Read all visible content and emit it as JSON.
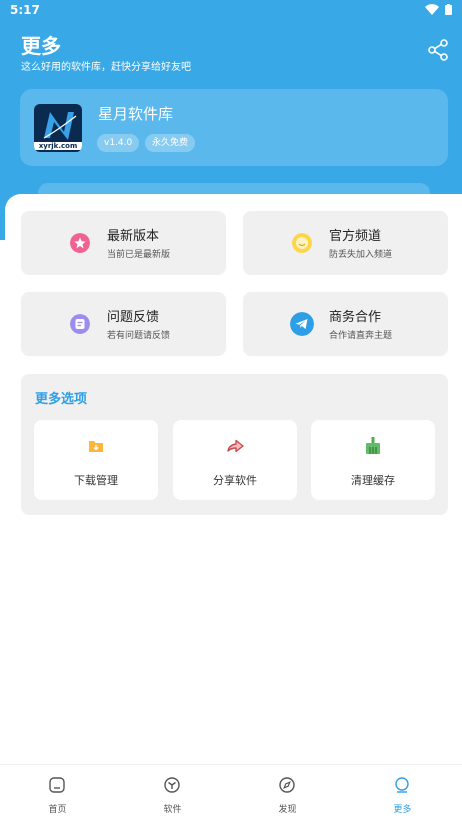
{
  "status": {
    "time": "5:17"
  },
  "header": {
    "title": "更多",
    "subtitle": "这么好用的软件库，赶快分享给好友吧"
  },
  "app": {
    "name": "星月软件库",
    "version": "v1.4.0",
    "free_badge": "永久免费",
    "logo_text": "xyrjk.com"
  },
  "tiles": [
    {
      "title": "最新版本",
      "subtitle": "当前已是最新版",
      "icon": "star-icon",
      "color": "#f06292"
    },
    {
      "title": "官方频道",
      "subtitle": "防丢失加入频道",
      "icon": "smile-icon",
      "color": "#fdd54a"
    },
    {
      "title": "问题反馈",
      "subtitle": "若有问题请反馈",
      "icon": "feedback-icon",
      "color": "#9c8cf0"
    },
    {
      "title": "商务合作",
      "subtitle": "合作请直奔主题",
      "icon": "telegram-icon",
      "color": "#2e9fe6"
    }
  ],
  "more": {
    "title": "更多选项",
    "options": [
      {
        "label": "下载管理",
        "icon": "download-folder-icon",
        "color": "#ffb43a"
      },
      {
        "label": "分享软件",
        "icon": "share-arrow-icon",
        "color": "#e57373"
      },
      {
        "label": "清理缓存",
        "icon": "broom-icon",
        "color": "#4caf50"
      }
    ]
  },
  "nav": [
    {
      "label": "首页",
      "icon": "home-icon",
      "active": false
    },
    {
      "label": "软件",
      "icon": "software-icon",
      "active": false
    },
    {
      "label": "发现",
      "icon": "compass-icon",
      "active": false
    },
    {
      "label": "更多",
      "icon": "more-icon",
      "active": true
    }
  ],
  "colors": {
    "header": "#38a8e6",
    "accent": "#2e9fe6",
    "tile_bg": "#f0f0f0"
  }
}
